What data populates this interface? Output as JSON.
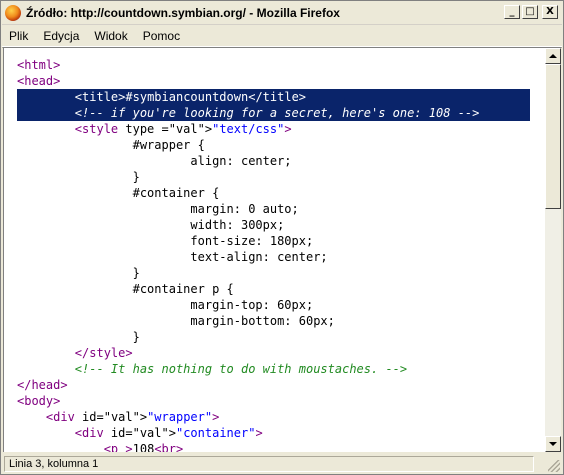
{
  "window": {
    "title": "Źródło: http://countdown.symbian.org/ - Mozilla Firefox",
    "controls": {
      "minimize": "_",
      "maximize": "□",
      "close": "X"
    }
  },
  "menu": [
    "Plik",
    "Edycja",
    "Widok",
    "Pomoc"
  ],
  "source_lines": [
    "<html>",
    "<head>",
    "        <title>#symbiancountdown</title>",
    "        <!-- if you're looking for a secret, here's one: 108 -->",
    "        <style type =\"text/css\">",
    "                #wrapper {",
    "                        align: center;",
    "                }",
    "                #container {",
    "                        margin: 0 auto;",
    "                        width: 300px;",
    "                        font-size: 180px;",
    "                        text-align: center;",
    "                }",
    "                #container p {",
    "                        margin-top: 60px;",
    "                        margin-bottom: 60px;",
    "                }",
    "        </style>",
    "        <!-- It has nothing to do with moustaches. -->",
    "</head>",
    "<body>",
    "    <div id=\"wrapper\">",
    "        <div id=\"container\">",
    "            <p >108<br>"
  ],
  "selected_lines": [
    2,
    3
  ],
  "status": {
    "text": "Linia 3, kolumna 1"
  },
  "colors": {
    "tag": "#800080",
    "value": "#0000ff",
    "comment": "#228b22",
    "selection": "#0a246a"
  },
  "icons": {
    "app": "firefox-icon",
    "scroll_up": "arrow-up-icon",
    "scroll_down": "arrow-down-icon"
  }
}
